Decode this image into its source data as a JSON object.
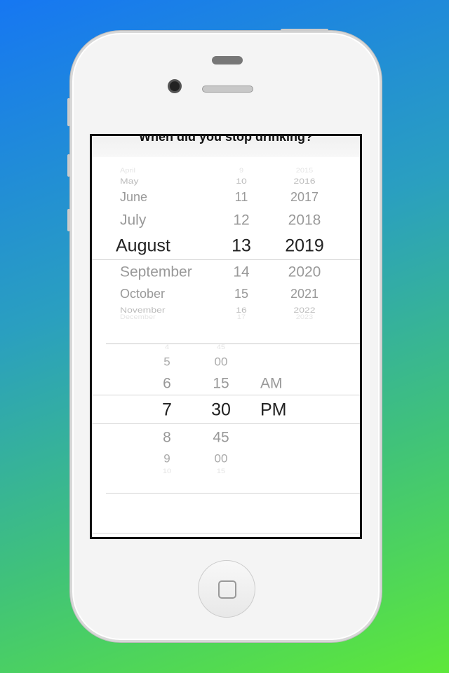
{
  "title": "When did you stop drinking?",
  "date_picker": {
    "months": [
      "April",
      "May",
      "June",
      "July",
      "August",
      "September",
      "October",
      "November",
      "December"
    ],
    "days": [
      "9",
      "10",
      "11",
      "12",
      "13",
      "14",
      "15",
      "16",
      "17"
    ],
    "years": [
      "2015",
      "2016",
      "2017",
      "2018",
      "2019",
      "2020",
      "2021",
      "2022",
      "2023"
    ],
    "selected": {
      "month": "August",
      "day": "13",
      "year": "2019"
    }
  },
  "time_picker": {
    "hours": [
      "4",
      "5",
      "6",
      "7",
      "8",
      "9",
      "10"
    ],
    "minutes": [
      "45",
      "00",
      "15",
      "30",
      "45",
      "00",
      "15"
    ],
    "ampm": [
      "",
      "",
      "AM",
      "PM",
      "",
      "",
      ""
    ],
    "selected": {
      "hour": "7",
      "minute": "30",
      "ampm": "PM"
    }
  }
}
